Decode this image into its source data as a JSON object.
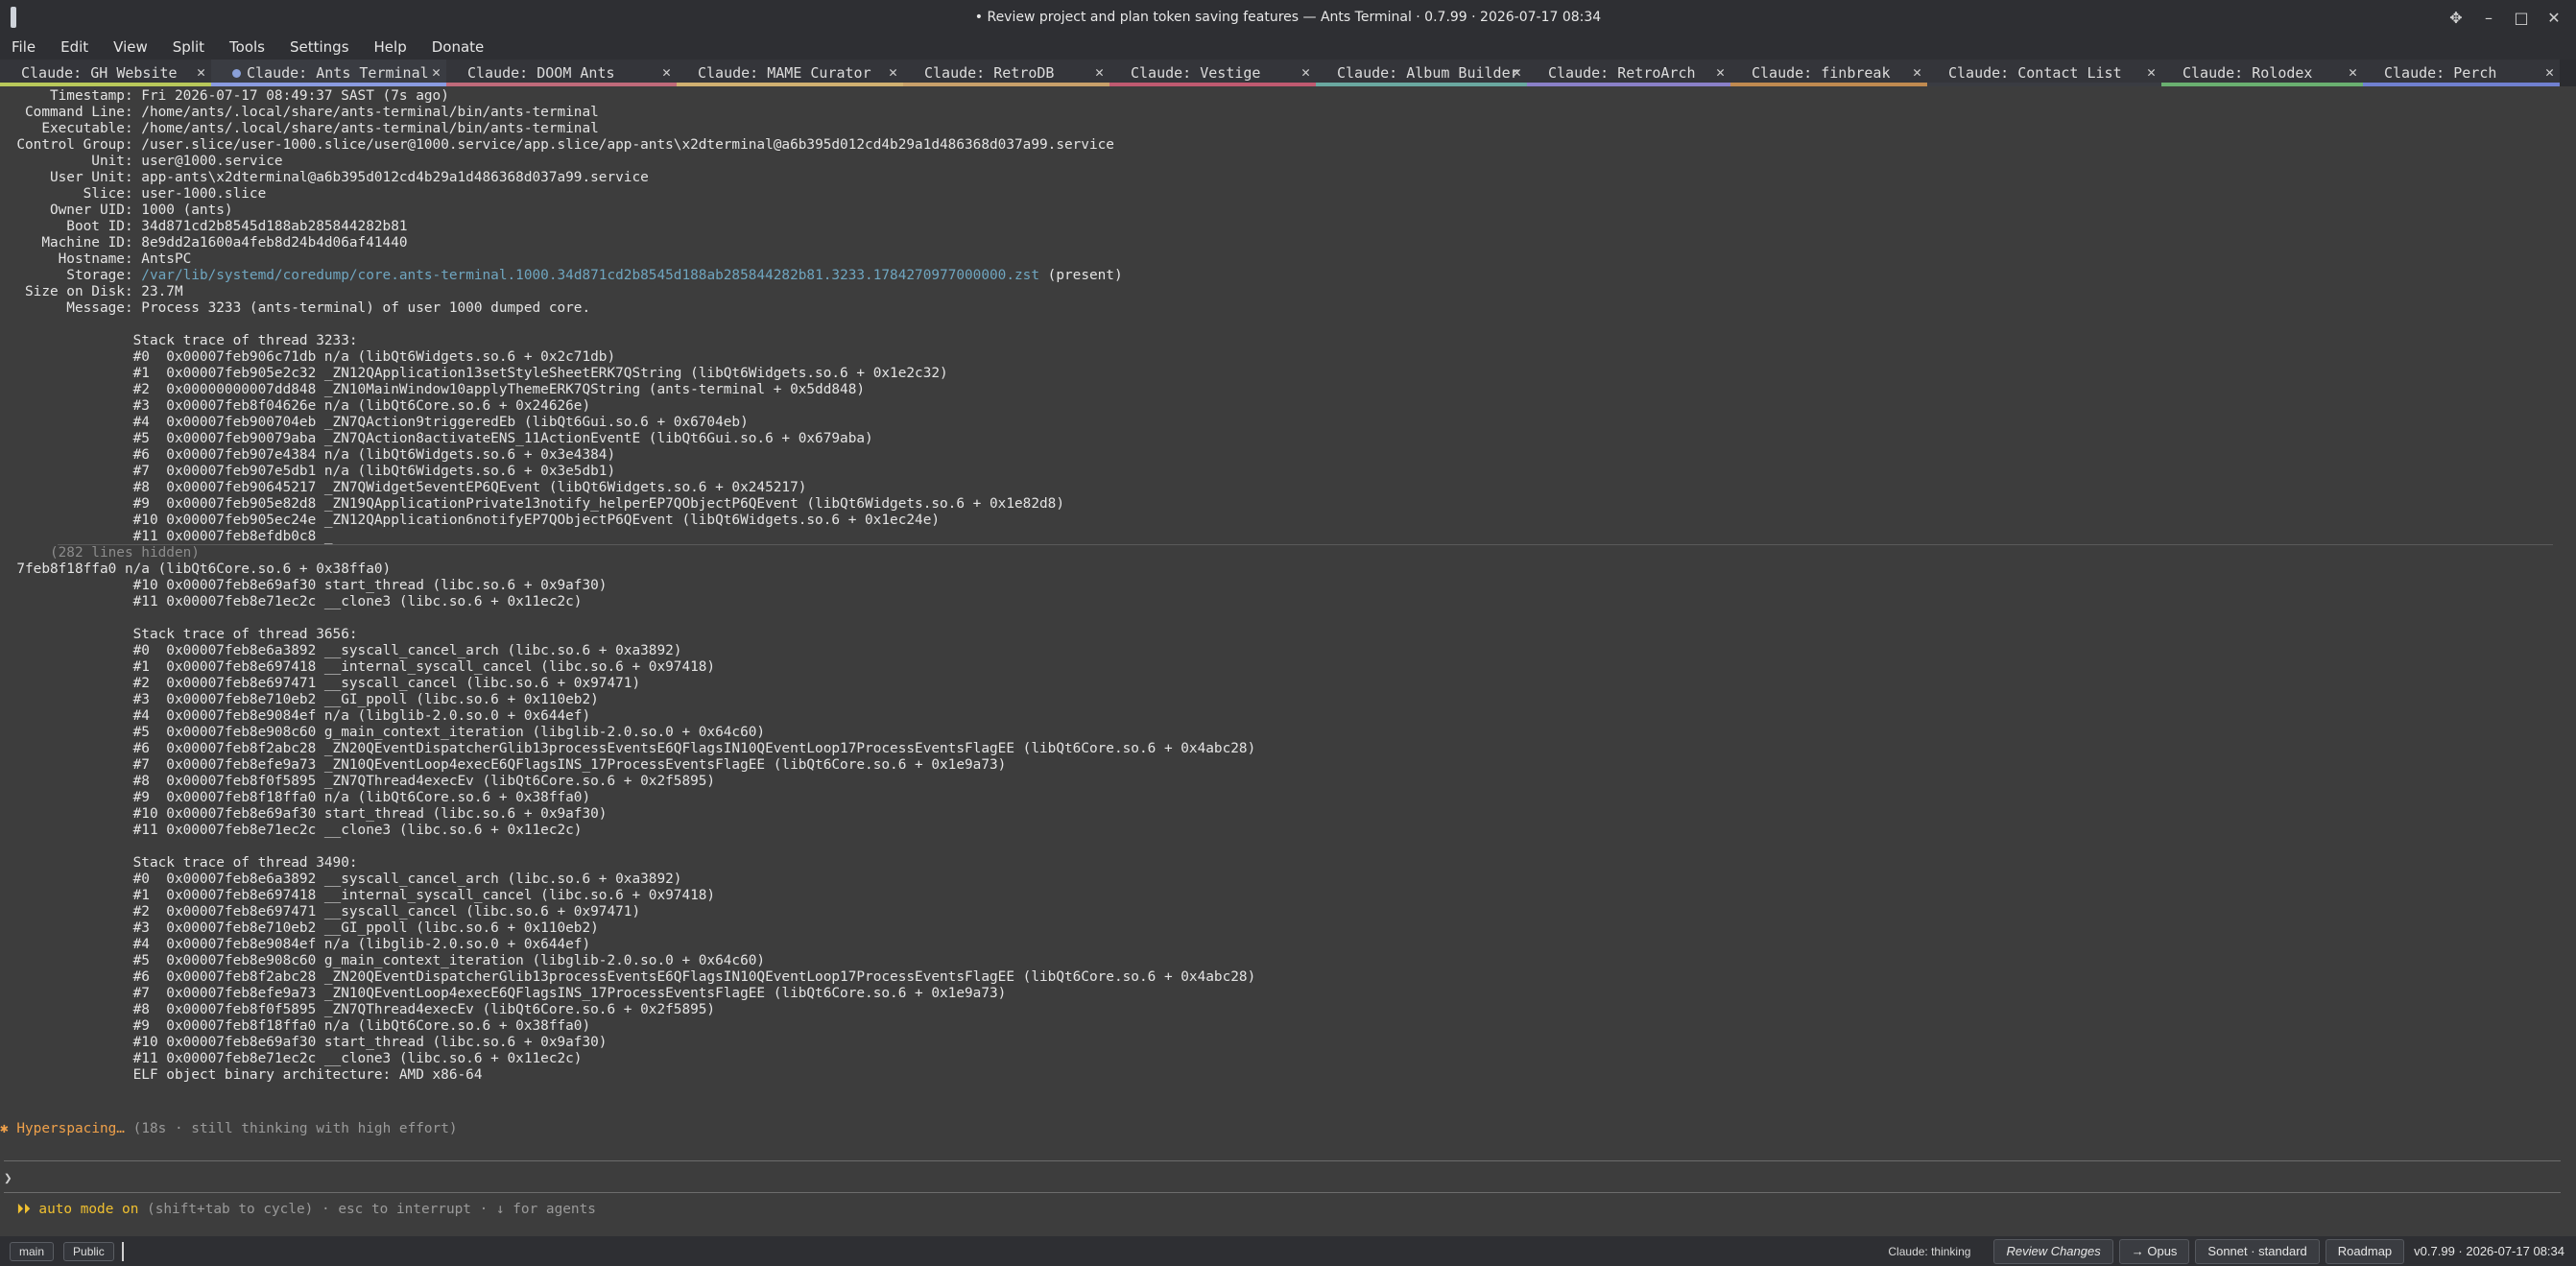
{
  "window": {
    "title": "• Review project and plan token saving features — Ants Terminal · 0.7.99 · 2026-07-17 08:34",
    "controls": [
      "✥",
      "–",
      "□",
      "✕"
    ]
  },
  "menu": [
    "File",
    "Edit",
    "View",
    "Split",
    "Tools",
    "Settings",
    "Help",
    "Donate"
  ],
  "tabs": [
    {
      "label": "Claude: GH Website",
      "color": "#b8c85a",
      "active": false
    },
    {
      "label": "Claude: Ants Terminal",
      "color": "#8a9be0",
      "active": true,
      "dot": true
    },
    {
      "label": "Claude: DOOM Ants",
      "color": "#c06a7a",
      "active": false
    },
    {
      "label": "Claude: MAME Curator",
      "color": "#d0b070",
      "active": false
    },
    {
      "label": "Claude: RetroDB",
      "color": "#c8a06a",
      "active": false
    },
    {
      "label": "Claude: Vestige",
      "color": "#c05a70",
      "active": false
    },
    {
      "label": "Claude: Album Builder",
      "color": "#6aa8a0",
      "active": false
    },
    {
      "label": "Claude: RetroArch",
      "color": "#8a80c8",
      "active": false
    },
    {
      "label": "Claude: finbreak",
      "color": "#c08a50",
      "active": false
    },
    {
      "label": "Claude: Contact List",
      "color": "#3a3c42",
      "active": false
    },
    {
      "label": "Claude: Rolodex",
      "color": "#6ab070",
      "active": false
    },
    {
      "label": "Claude: Perch",
      "color": "#7080d0",
      "active": false
    }
  ],
  "terminal": {
    "header": [
      {
        "k": "      Timestamp:",
        "v": " Fri 2026-07-17 08:49:37 SAST (7s ago)"
      },
      {
        "k": "   Command Line:",
        "v": " /home/ants/.local/share/ants-terminal/bin/ants-terminal"
      },
      {
        "k": "     Executable:",
        "v": " /home/ants/.local/share/ants-terminal/bin/ants-terminal"
      },
      {
        "k": "  Control Group:",
        "v": " /user.slice/user-1000.slice/user@1000.service/app.slice/app-ants\\x2dterminal@a6b395d012cd4b29a1d486368d037a99.service"
      },
      {
        "k": "           Unit:",
        "v": " user@1000.service"
      },
      {
        "k": "      User Unit:",
        "v": " app-ants\\x2dterminal@a6b395d012cd4b29a1d486368d037a99.service"
      },
      {
        "k": "          Slice:",
        "v": " user-1000.slice"
      },
      {
        "k": "      Owner UID:",
        "v": " 1000 (ants)"
      },
      {
        "k": "        Boot ID:",
        "v": " 34d871cd2b8545d188ab285844282b81"
      },
      {
        "k": "     Machine ID:",
        "v": " 8e9dd2a1600a4feb8d24b4d06af41440"
      },
      {
        "k": "       Hostname:",
        "v": " AntsPC"
      }
    ],
    "storage_key": "        Storage:",
    "storage_path": "/var/lib/systemd/coredump/core.ants-terminal.1000.34d871cd2b8545d188ab285844282b81.3233.1784270977000000.zst",
    "storage_suffix": " (present)",
    "size_line": "   Size on Disk: 23.7M",
    "message_line": "        Message: Process 3233 (ants-terminal) of user 1000 dumped core.",
    "thread1_title": "                Stack trace of thread 3233:",
    "thread1": [
      "                #0  0x00007feb906c71db n/a (libQt6Widgets.so.6 + 0x2c71db)",
      "                #1  0x00007feb905e2c32 _ZN12QApplication13setStyleSheetERK7QString (libQt6Widgets.so.6 + 0x1e2c32)",
      "                #2  0x00000000007dd848 _ZN10MainWindow10applyThemeERK7QString (ants-terminal + 0x5dd848)",
      "                #3  0x00007feb8f04626e n/a (libQt6Core.so.6 + 0x24626e)",
      "                #4  0x00007feb900704eb _ZN7QAction9triggeredEb (libQt6Gui.so.6 + 0x6704eb)",
      "                #5  0x00007feb90079aba _ZN7QAction8activateENS_11ActionEventE (libQt6Gui.so.6 + 0x679aba)",
      "                #6  0x00007feb907e4384 n/a (libQt6Widgets.so.6 + 0x3e4384)",
      "                #7  0x00007feb907e5db1 n/a (libQt6Widgets.so.6 + 0x3e5db1)",
      "                #8  0x00007feb90645217 _ZN7QWidget5eventEP6QEvent (libQt6Widgets.so.6 + 0x245217)",
      "                #9  0x00007feb905e82d8 _ZN19QApplicationPrivate13notify_helperEP7QObjectP6QEvent (libQt6Widgets.so.6 + 0x1e82d8)",
      "                #10 0x00007feb905ec24e _ZN12QApplication6notifyEP7QObjectP6QEvent (libQt6Widgets.so.6 + 0x1ec24e)",
      "                #11 0x00007feb8efdb0c8 _"
    ],
    "hidden": "      (282 lines hidden)",
    "after_hidden": [
      "  7feb8f18ffa0 n/a (libQt6Core.so.6 + 0x38ffa0)",
      "                #10 0x00007feb8e69af30 start_thread (libc.so.6 + 0x9af30)",
      "                #11 0x00007feb8e71ec2c __clone3 (libc.so.6 + 0x11ec2c)",
      ""
    ],
    "thread2_title": "                Stack trace of thread 3656:",
    "thread2": [
      "                #0  0x00007feb8e6a3892 __syscall_cancel_arch (libc.so.6 + 0xa3892)",
      "                #1  0x00007feb8e697418 __internal_syscall_cancel (libc.so.6 + 0x97418)",
      "                #2  0x00007feb8e697471 __syscall_cancel (libc.so.6 + 0x97471)",
      "                #3  0x00007feb8e710eb2 __GI_ppoll (libc.so.6 + 0x110eb2)",
      "                #4  0x00007feb8e9084ef n/a (libglib-2.0.so.0 + 0x644ef)",
      "                #5  0x00007feb8e908c60 g_main_context_iteration (libglib-2.0.so.0 + 0x64c60)",
      "                #6  0x00007feb8f2abc28 _ZN20QEventDispatcherGlib13processEventsE6QFlagsIN10QEventLoop17ProcessEventsFlagEE (libQt6Core.so.6 + 0x4abc28)",
      "                #7  0x00007feb8efe9a73 _ZN10QEventLoop4execE6QFlagsINS_17ProcessEventsFlagEE (libQt6Core.so.6 + 0x1e9a73)",
      "                #8  0x00007feb8f0f5895 _ZN7QThread4execEv (libQt6Core.so.6 + 0x2f5895)",
      "                #9  0x00007feb8f18ffa0 n/a (libQt6Core.so.6 + 0x38ffa0)",
      "                #10 0x00007feb8e69af30 start_thread (libc.so.6 + 0x9af30)",
      "                #11 0x00007feb8e71ec2c __clone3 (libc.so.6 + 0x11ec2c)",
      ""
    ],
    "thread3_title": "                Stack trace of thread 3490:",
    "thread3": [
      "                #0  0x00007feb8e6a3892 __syscall_cancel_arch (libc.so.6 + 0xa3892)",
      "                #1  0x00007feb8e697418 __internal_syscall_cancel (libc.so.6 + 0x97418)",
      "                #2  0x00007feb8e697471 __syscall_cancel (libc.so.6 + 0x97471)",
      "                #3  0x00007feb8e710eb2 __GI_ppoll (libc.so.6 + 0x110eb2)",
      "                #4  0x00007feb8e9084ef n/a (libglib-2.0.so.0 + 0x644ef)",
      "                #5  0x00007feb8e908c60 g_main_context_iteration (libglib-2.0.so.0 + 0x64c60)",
      "                #6  0x00007feb8f2abc28 _ZN20QEventDispatcherGlib13processEventsE6QFlagsIN10QEventLoop17ProcessEventsFlagEE (libQt6Core.so.6 + 0x4abc28)",
      "                #7  0x00007feb8efe9a73 _ZN10QEventLoop4execE6QFlagsINS_17ProcessEventsFlagEE (libQt6Core.so.6 + 0x1e9a73)",
      "                #8  0x00007feb8f0f5895 _ZN7QThread4execEv (libQt6Core.so.6 + 0x2f5895)",
      "                #9  0x00007feb8f18ffa0 n/a (libQt6Core.so.6 + 0x38ffa0)",
      "                #10 0x00007feb8e69af30 start_thread (libc.so.6 + 0x9af30)",
      "                #11 0x00007feb8e71ec2c __clone3 (libc.so.6 + 0x11ec2c)",
      "                ELF object binary architecture: AMD x86-64"
    ]
  },
  "status": {
    "thinking_icon": "✱",
    "thinking_label": "Hyperspacing…",
    "thinking_detail": "(18s · still thinking with high effort)",
    "prompt_symbol": "❯",
    "auto_icon": "⏵⏵",
    "auto_label": "auto mode on",
    "auto_hint": "(shift+tab to cycle) · esc to interrupt · ↓ for agents"
  },
  "statusbar": {
    "branch": "main",
    "visibility": "Public",
    "claude_state": "Claude: thinking",
    "review_button": "Review Changes",
    "opus_button": "→ Opus",
    "sonnet_button": "Sonnet · standard",
    "roadmap_button": "Roadmap",
    "version": "v0.7.99 · 2026-07-17 08:34"
  },
  "colors": {
    "background": "#3d3d3d",
    "link": "#6fa6c0",
    "thinking": "#f0a14a",
    "auto_mode": "#f0c030"
  }
}
